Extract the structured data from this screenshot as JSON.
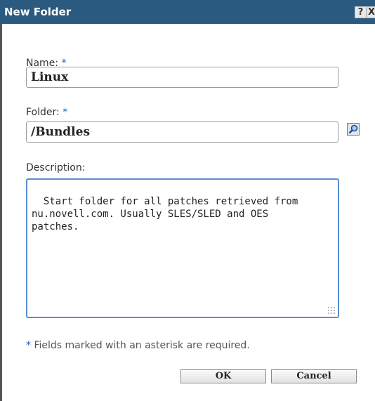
{
  "dialog": {
    "title": "New Folder",
    "help_label": "?",
    "close_label": "X"
  },
  "form": {
    "name": {
      "label": "Name:",
      "required_mark": "*",
      "value": "Linux"
    },
    "folder": {
      "label": "Folder:",
      "required_mark": "*",
      "value": "/Bundles"
    },
    "description": {
      "label": "Description:",
      "value": "Start folder for all patches retrieved from\nnu.novell.com. Usually SLES/SLED and OES\npatches."
    },
    "footnote": {
      "mark": "*",
      "text": " Fields marked with an asterisk are required."
    }
  },
  "buttons": {
    "ok": "OK",
    "cancel": "Cancel"
  },
  "icons": {
    "folder_lookup": "search-icon"
  },
  "colors": {
    "titlebar": "#2a5a80",
    "required": "#1e64b4",
    "focus_border": "#5a8fd0"
  }
}
